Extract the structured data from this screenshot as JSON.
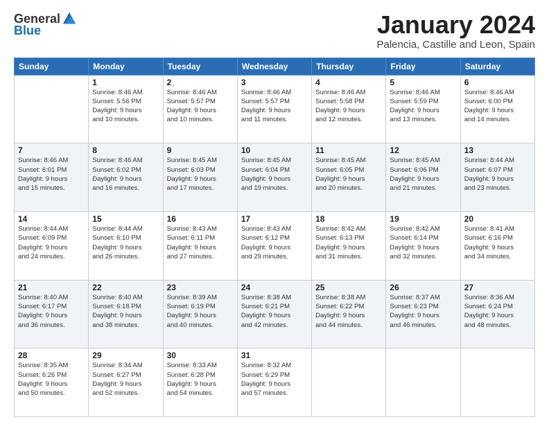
{
  "logo": {
    "general": "General",
    "blue": "Blue"
  },
  "header": {
    "month_title": "January 2024",
    "location": "Palencia, Castille and Leon, Spain"
  },
  "weekdays": [
    "Sunday",
    "Monday",
    "Tuesday",
    "Wednesday",
    "Thursday",
    "Friday",
    "Saturday"
  ],
  "weeks": [
    [
      {
        "day": "",
        "info": ""
      },
      {
        "day": "1",
        "info": "Sunrise: 8:46 AM\nSunset: 5:56 PM\nDaylight: 9 hours\nand 10 minutes."
      },
      {
        "day": "2",
        "info": "Sunrise: 8:46 AM\nSunset: 5:57 PM\nDaylight: 9 hours\nand 10 minutes."
      },
      {
        "day": "3",
        "info": "Sunrise: 8:46 AM\nSunset: 5:57 PM\nDaylight: 9 hours\nand 11 minutes."
      },
      {
        "day": "4",
        "info": "Sunrise: 8:46 AM\nSunset: 5:58 PM\nDaylight: 9 hours\nand 12 minutes."
      },
      {
        "day": "5",
        "info": "Sunrise: 8:46 AM\nSunset: 5:59 PM\nDaylight: 9 hours\nand 13 minutes."
      },
      {
        "day": "6",
        "info": "Sunrise: 8:46 AM\nSunset: 6:00 PM\nDaylight: 9 hours\nand 14 minutes."
      }
    ],
    [
      {
        "day": "7",
        "info": "Sunrise: 8:46 AM\nSunset: 6:01 PM\nDaylight: 9 hours\nand 15 minutes."
      },
      {
        "day": "8",
        "info": "Sunrise: 8:46 AM\nSunset: 6:02 PM\nDaylight: 9 hours\nand 16 minutes."
      },
      {
        "day": "9",
        "info": "Sunrise: 8:45 AM\nSunset: 6:03 PM\nDaylight: 9 hours\nand 17 minutes."
      },
      {
        "day": "10",
        "info": "Sunrise: 8:45 AM\nSunset: 6:04 PM\nDaylight: 9 hours\nand 19 minutes."
      },
      {
        "day": "11",
        "info": "Sunrise: 8:45 AM\nSunset: 6:05 PM\nDaylight: 9 hours\nand 20 minutes."
      },
      {
        "day": "12",
        "info": "Sunrise: 8:45 AM\nSunset: 6:06 PM\nDaylight: 9 hours\nand 21 minutes."
      },
      {
        "day": "13",
        "info": "Sunrise: 8:44 AM\nSunset: 6:07 PM\nDaylight: 9 hours\nand 23 minutes."
      }
    ],
    [
      {
        "day": "14",
        "info": "Sunrise: 8:44 AM\nSunset: 6:09 PM\nDaylight: 9 hours\nand 24 minutes."
      },
      {
        "day": "15",
        "info": "Sunrise: 8:44 AM\nSunset: 6:10 PM\nDaylight: 9 hours\nand 26 minutes."
      },
      {
        "day": "16",
        "info": "Sunrise: 8:43 AM\nSunset: 6:11 PM\nDaylight: 9 hours\nand 27 minutes."
      },
      {
        "day": "17",
        "info": "Sunrise: 8:43 AM\nSunset: 6:12 PM\nDaylight: 9 hours\nand 29 minutes."
      },
      {
        "day": "18",
        "info": "Sunrise: 8:42 AM\nSunset: 6:13 PM\nDaylight: 9 hours\nand 31 minutes."
      },
      {
        "day": "19",
        "info": "Sunrise: 8:42 AM\nSunset: 6:14 PM\nDaylight: 9 hours\nand 32 minutes."
      },
      {
        "day": "20",
        "info": "Sunrise: 8:41 AM\nSunset: 6:16 PM\nDaylight: 9 hours\nand 34 minutes."
      }
    ],
    [
      {
        "day": "21",
        "info": "Sunrise: 8:40 AM\nSunset: 6:17 PM\nDaylight: 9 hours\nand 36 minutes."
      },
      {
        "day": "22",
        "info": "Sunrise: 8:40 AM\nSunset: 6:18 PM\nDaylight: 9 hours\nand 38 minutes."
      },
      {
        "day": "23",
        "info": "Sunrise: 8:39 AM\nSunset: 6:19 PM\nDaylight: 9 hours\nand 40 minutes."
      },
      {
        "day": "24",
        "info": "Sunrise: 8:38 AM\nSunset: 6:21 PM\nDaylight: 9 hours\nand 42 minutes."
      },
      {
        "day": "25",
        "info": "Sunrise: 8:38 AM\nSunset: 6:22 PM\nDaylight: 9 hours\nand 44 minutes."
      },
      {
        "day": "26",
        "info": "Sunrise: 8:37 AM\nSunset: 6:23 PM\nDaylight: 9 hours\nand 46 minutes."
      },
      {
        "day": "27",
        "info": "Sunrise: 8:36 AM\nSunset: 6:24 PM\nDaylight: 9 hours\nand 48 minutes."
      }
    ],
    [
      {
        "day": "28",
        "info": "Sunrise: 8:35 AM\nSunset: 6:26 PM\nDaylight: 9 hours\nand 50 minutes."
      },
      {
        "day": "29",
        "info": "Sunrise: 8:34 AM\nSunset: 6:27 PM\nDaylight: 9 hours\nand 52 minutes."
      },
      {
        "day": "30",
        "info": "Sunrise: 8:33 AM\nSunset: 6:28 PM\nDaylight: 9 hours\nand 54 minutes."
      },
      {
        "day": "31",
        "info": "Sunrise: 8:32 AM\nSunset: 6:29 PM\nDaylight: 9 hours\nand 57 minutes."
      },
      {
        "day": "",
        "info": ""
      },
      {
        "day": "",
        "info": ""
      },
      {
        "day": "",
        "info": ""
      }
    ]
  ]
}
